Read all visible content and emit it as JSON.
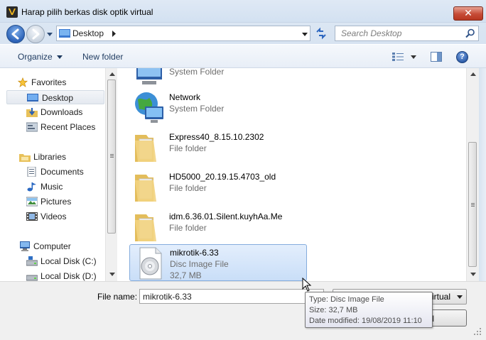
{
  "window": {
    "title": "Harap pilih berkas disk optik virtual",
    "close_glyph": "✕"
  },
  "address_bar": {
    "location": "Desktop",
    "search_placeholder": "Search Desktop"
  },
  "toolbar": {
    "organize_label": "Organize",
    "new_folder_label": "New folder",
    "help_glyph": "?"
  },
  "nav_pane": {
    "favorites": {
      "label": "Favorites",
      "icon": "star-icon"
    },
    "favorites_items": [
      {
        "label": "Desktop",
        "icon": "desktop-icon",
        "selected": true
      },
      {
        "label": "Downloads",
        "icon": "downloads-icon"
      },
      {
        "label": "Recent Places",
        "icon": "recent-places-icon"
      }
    ],
    "libraries": {
      "label": "Libraries",
      "icon": "libraries-icon"
    },
    "libraries_items": [
      {
        "label": "Documents",
        "icon": "documents-icon"
      },
      {
        "label": "Music",
        "icon": "music-icon"
      },
      {
        "label": "Pictures",
        "icon": "pictures-icon"
      },
      {
        "label": "Videos",
        "icon": "videos-icon"
      }
    ],
    "computer": {
      "label": "Computer",
      "icon": "computer-icon"
    },
    "computer_items": [
      {
        "label": "Local Disk (C:)",
        "icon": "local-disk-icon"
      },
      {
        "label": "Local Disk (D:)",
        "icon": "local-disk-icon"
      }
    ]
  },
  "files": [
    {
      "name": "",
      "type": "System Folder",
      "icon": "system-folder-icon"
    },
    {
      "name": "Network",
      "type": "System Folder",
      "icon": "network-icon"
    },
    {
      "name": "Express40_8.15.10.2302",
      "type": "File folder",
      "icon": "folder-icon"
    },
    {
      "name": "HD5000_20.19.15.4703_old",
      "type": "File folder",
      "icon": "folder-icon"
    },
    {
      "name": "idm.6.36.01.Silent.kuyhAa.Me",
      "type": "File folder",
      "icon": "folder-icon"
    },
    {
      "name": "mikrotik-6.33",
      "type": "Disc Image File",
      "size": "32,7 MB",
      "icon": "disc-image-icon",
      "selected": true
    }
  ],
  "bottom": {
    "file_name_label": "File name:",
    "file_name_value": "mikrotik-6.33",
    "filter_visible": "irtual",
    "cancel_visible": "ncel"
  },
  "tooltip": {
    "type_line": "Type: Disc Image File",
    "size_line": "Size: 32,7 MB",
    "date_line": "Date modified: 19/08/2019 11:10"
  },
  "colors": {
    "selection_bg": "#cde0f8",
    "selection_border": "#84acdd",
    "title_bar": "#d9e5f3",
    "close_button": "#c64b36"
  }
}
